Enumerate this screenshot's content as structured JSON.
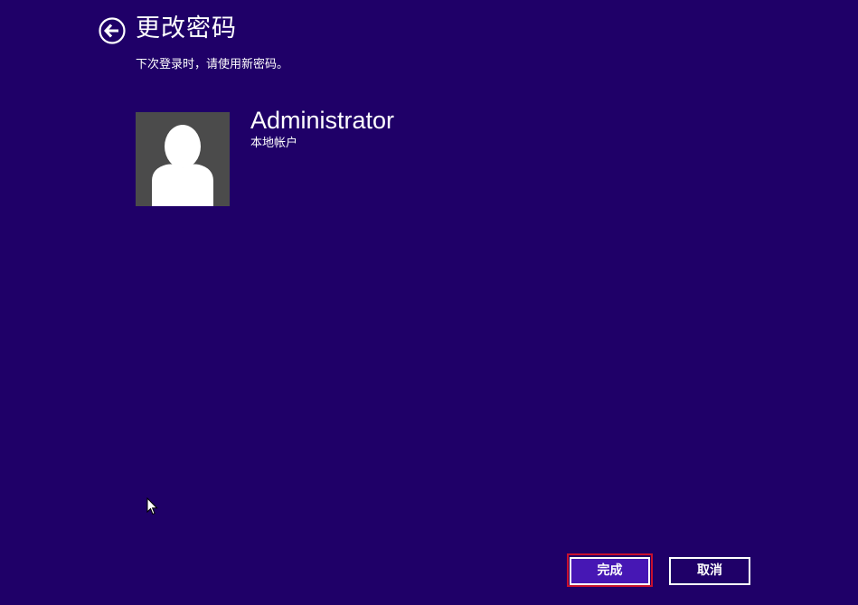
{
  "header": {
    "back_icon": "back-arrow-icon",
    "title": "更改密码",
    "subtitle": "下次登录时，请使用新密码。"
  },
  "account": {
    "avatar_icon": "user-avatar-icon",
    "name": "Administrator",
    "type": "本地帐户"
  },
  "actions": {
    "finish_label": "完成",
    "cancel_label": "取消"
  },
  "colors": {
    "background": "#1f0068",
    "primary_button": "#4617b4",
    "focus_ring": "#c8102e",
    "avatar_bg": "#4b4b4b"
  }
}
